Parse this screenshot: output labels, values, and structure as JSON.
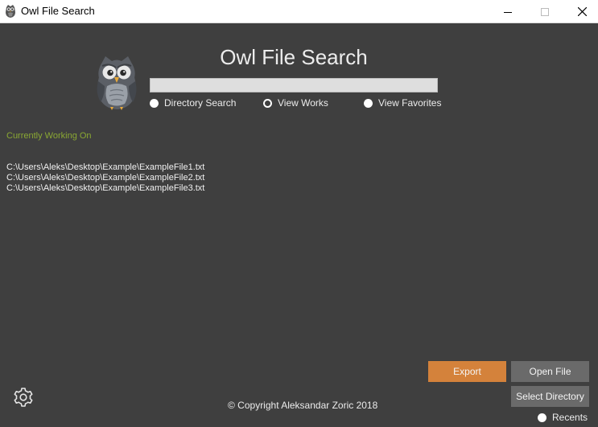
{
  "window": {
    "title": "Owl File Search",
    "controls": {
      "minimize": "minimize-icon",
      "maximize": "maximize-icon",
      "close": "close-icon"
    }
  },
  "header": {
    "app_title": "Owl File Search",
    "logo": "owl-icon",
    "search": {
      "value": "",
      "placeholder": ""
    }
  },
  "modes": [
    {
      "label": "Directory Search",
      "checked": false
    },
    {
      "label": "View Works",
      "checked": true
    },
    {
      "label": "View Favorites",
      "checked": false
    }
  ],
  "status": {
    "label": "Currently Working On"
  },
  "files": [
    "C:\\Users\\Aleks\\Desktop\\Example\\ExampleFile1.txt",
    "C:\\Users\\Aleks\\Desktop\\Example\\ExampleFile2.txt",
    "C:\\Users\\Aleks\\Desktop\\Example\\ExampleFile3.txt"
  ],
  "actions": {
    "export": "Export",
    "open_file": "Open File",
    "select_directory": "Select Directory"
  },
  "recents": {
    "label": "Recents",
    "checked": false
  },
  "footer": {
    "copyright": "© Copyright Aleksandar Zoric 2018"
  },
  "colors": {
    "background": "#3f3f3f",
    "accent": "#d4823b",
    "status_text": "#8aa833",
    "button": "#6a6a6a"
  }
}
